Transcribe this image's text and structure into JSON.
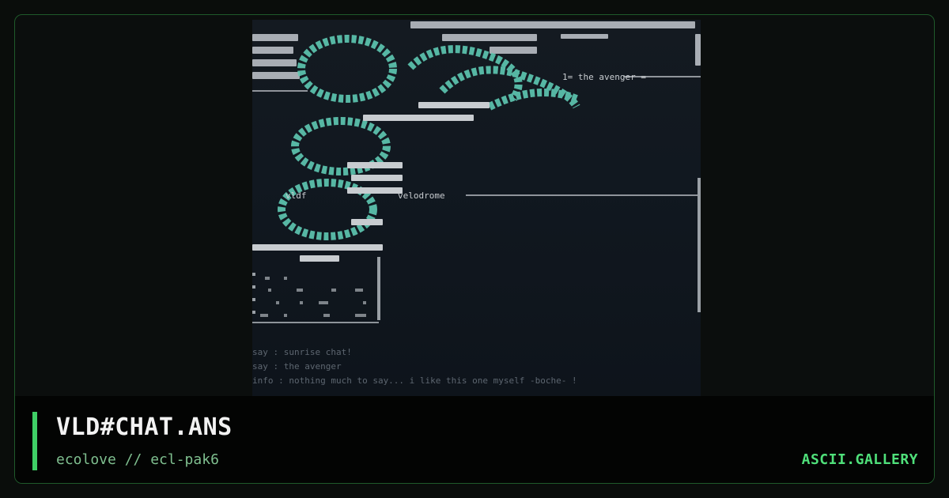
{
  "artwork": {
    "lines": [
      "1= the avenger =",
      "vldf",
      "velodrome",
      "say : sunrise chat!",
      "say : the avenger",
      "info : nothing much to say... i like this one myself -boche- !"
    ]
  },
  "caption": {
    "title": "VLD#CHAT.ANS",
    "subtitle": "ecolove // ecl-pak6",
    "brand": "ASCII.GALLERY"
  },
  "colors": {
    "accent": "#3fcf66",
    "art_cyan": "#5fc9b3",
    "art_grey": "#c8ccd0",
    "background": "#0a0d0b"
  }
}
